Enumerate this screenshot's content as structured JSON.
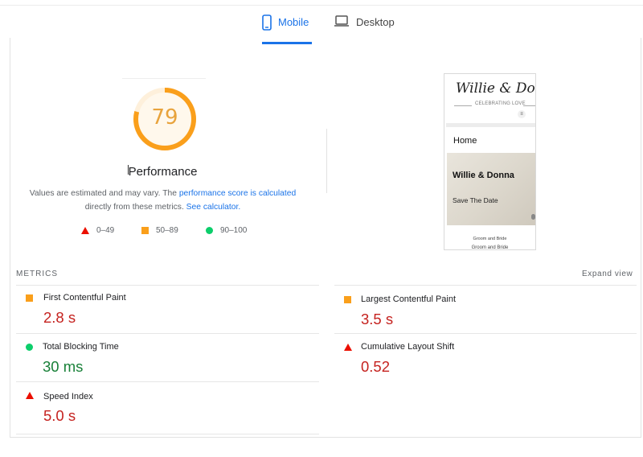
{
  "tabs": {
    "mobile": "Mobile",
    "desktop": "Desktop"
  },
  "performance": {
    "score": "79",
    "score_fraction": 0.79,
    "title": "Performance",
    "desc_prefix": "Values are estimated and may vary. The ",
    "desc_link1": "performance score is calculated",
    "desc_middle": " directly from these metrics. ",
    "desc_link2": "See calculator.",
    "colors": {
      "fail": "#eb0f00",
      "average": "#fa9f1b",
      "pass": "#0cce6b"
    }
  },
  "legend": [
    {
      "icon": "triangle",
      "label": "0–49"
    },
    {
      "icon": "square",
      "label": "50–89"
    },
    {
      "icon": "circle",
      "label": "90–100"
    }
  ],
  "preview": {
    "site_title": "Willie & Donna",
    "site_subtitle": "CELEBRATING LOVE",
    "menu_glyph": "≡",
    "nav_home": "Home",
    "hero_title": "Willie & Donna",
    "hero_subtitle": "Save The Date",
    "section_label": "Groom and Bride",
    "section_label2": "Groom and Bride"
  },
  "metrics": {
    "label": "METRICS",
    "expand": "Expand view",
    "items": [
      {
        "name": "First Contentful Paint",
        "value": "2.8 s",
        "status": "average"
      },
      {
        "name": "Largest Contentful Paint",
        "value": "3.5 s",
        "status": "average"
      },
      {
        "name": "Total Blocking Time",
        "value": "30 ms",
        "status": "pass"
      },
      {
        "name": "Cumulative Layout Shift",
        "value": "0.52",
        "status": "fail"
      },
      {
        "name": "Speed Index",
        "value": "5.0 s",
        "status": "fail"
      }
    ]
  }
}
